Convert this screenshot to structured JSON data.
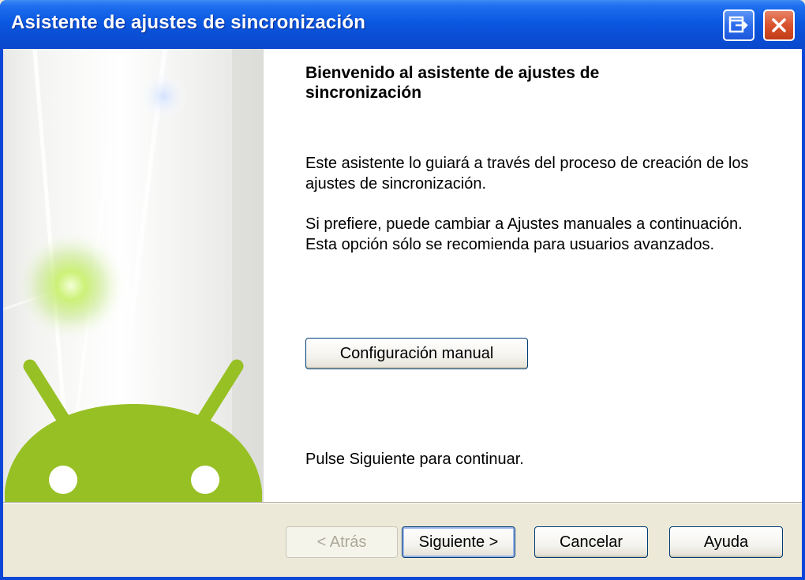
{
  "window": {
    "title": "Asistente de ajustes de sincronización",
    "title_buttons": [
      {
        "name": "help-icon"
      },
      {
        "name": "close-icon"
      }
    ]
  },
  "side_panel": {
    "illustration": "android-robot-head-icon",
    "colors": {
      "android_green": "#97c024",
      "glow": "#c8f06a"
    }
  },
  "content": {
    "heading": "Bienvenido al asistente de ajustes de sincronización",
    "paragraph_1": "Este asistente lo guiará a través del proceso de creación de los ajustes de sincronización.",
    "paragraph_2": "Si prefiere, puede cambiar a Ajustes manuales a continuación. Esta opción sólo se recomienda para usuarios avanzados.",
    "manual_button_label": "Configuración manual",
    "continue_hint": "Pulse Siguiente para continuar."
  },
  "footer": {
    "back_label": "< Atrás",
    "back_enabled": false,
    "next_label": "Siguiente >",
    "cancel_label": "Cancelar",
    "help_label": "Ayuda"
  },
  "colors": {
    "titlebar": "#0a4fd6",
    "close_button": "#d8532e",
    "dialog_background": "#ece9d8",
    "button_border": "#003c74"
  }
}
